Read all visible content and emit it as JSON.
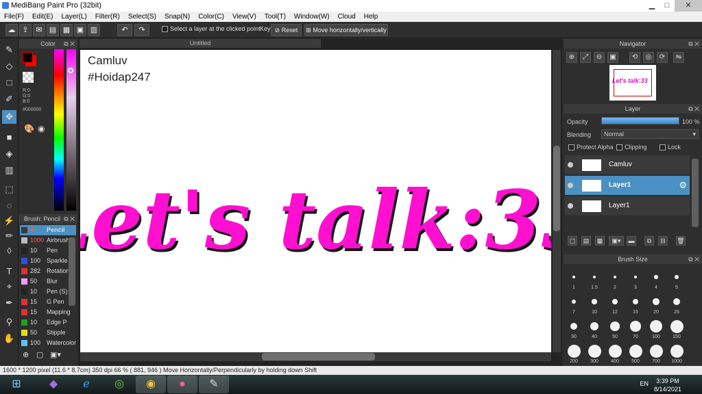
{
  "window": {
    "title": "MediBang Paint Pro (32bit)",
    "minimize": "▁",
    "maximize": "□",
    "close": "✕"
  },
  "menu": [
    "File(F)",
    "Edit(E)",
    "Layer(L)",
    "Filter(R)",
    "Select(S)",
    "Snap(N)",
    "Color(C)",
    "View(V)",
    "Tool(T)",
    "Window(W)",
    "Cloud",
    "Help"
  ],
  "toolbar": {
    "select_layer_label": "Select a layer at the clicked point",
    "key_label": "Key",
    "reset_label": "Reset",
    "move_label": "Move horizontally/vertically"
  },
  "document": {
    "tab_title": "Untitled",
    "caption1": "Camluv",
    "caption2": "#Hoidap247",
    "art_text": "Let's talk:33",
    "art_color": "#ff10d0"
  },
  "color_panel": {
    "title": "Color",
    "r": "R:0",
    "g": "G:0",
    "b": "B:0",
    "hex": "#000000",
    "primary": "#000000",
    "secondary": "#ff0000"
  },
  "brush_panel": {
    "title": "Brush: Pencil",
    "items": [
      {
        "size": "4",
        "name": "Pencil",
        "color": "#3a3a3a"
      },
      {
        "size": "1000",
        "name": "Airbrush",
        "color": "#bbbbbb"
      },
      {
        "size": "10",
        "name": "Pen",
        "color": "#222222"
      },
      {
        "size": "100",
        "name": "Sparkle",
        "color": "#3050e0"
      },
      {
        "size": "282",
        "name": "Rotation",
        "color": "#e03030"
      },
      {
        "size": "50",
        "name": "Blur",
        "color": "#ff99ff"
      },
      {
        "size": "10",
        "name": "Pen (S)",
        "color": "#222222"
      },
      {
        "size": "15",
        "name": "G Pen",
        "color": "#e03030"
      },
      {
        "size": "15",
        "name": "Mapping",
        "color": "#e03030"
      },
      {
        "size": "10",
        "name": "Edge P",
        "color": "#20a020"
      },
      {
        "size": "50",
        "name": "Stipple",
        "color": "#dddd20"
      },
      {
        "size": "100",
        "name": "Watercolor",
        "color": "#60c0ff"
      }
    ]
  },
  "navigator": {
    "title": "Navigator",
    "preview_text": "Let's talk:33"
  },
  "layer_panel": {
    "title": "Layer",
    "opacity_label": "Opacity",
    "opacity_value": "100 %",
    "opacity_fraction": 1.0,
    "blending_label": "Blending",
    "blending_value": "Normal",
    "protect_alpha": "Protect Alpha",
    "clipping": "Clipping",
    "lock": "Lock",
    "layers": [
      {
        "name": "Camluv",
        "selected": false
      },
      {
        "name": "Layer1",
        "selected": true
      },
      {
        "name": "Layer1",
        "selected": false
      }
    ]
  },
  "brush_size": {
    "title": "Brush Size",
    "sizes": [
      "1",
      "1.5",
      "2",
      "3",
      "4",
      "5",
      "7",
      "10",
      "12",
      "15",
      "20",
      "25",
      "30",
      "40",
      "50",
      "70",
      "100",
      "150",
      "200",
      "300",
      "400",
      "500",
      "700",
      "1000"
    ]
  },
  "status": "1600 * 1200 pixel   (11.6 * 8.7cm)   350 dpi   66 %   ( 881, 946 )   Move Horizontally/Perpendicularly by holding down Shift",
  "taskbar": {
    "lang": "EN",
    "time": "3:39 PM",
    "date": "8/14/2021"
  }
}
